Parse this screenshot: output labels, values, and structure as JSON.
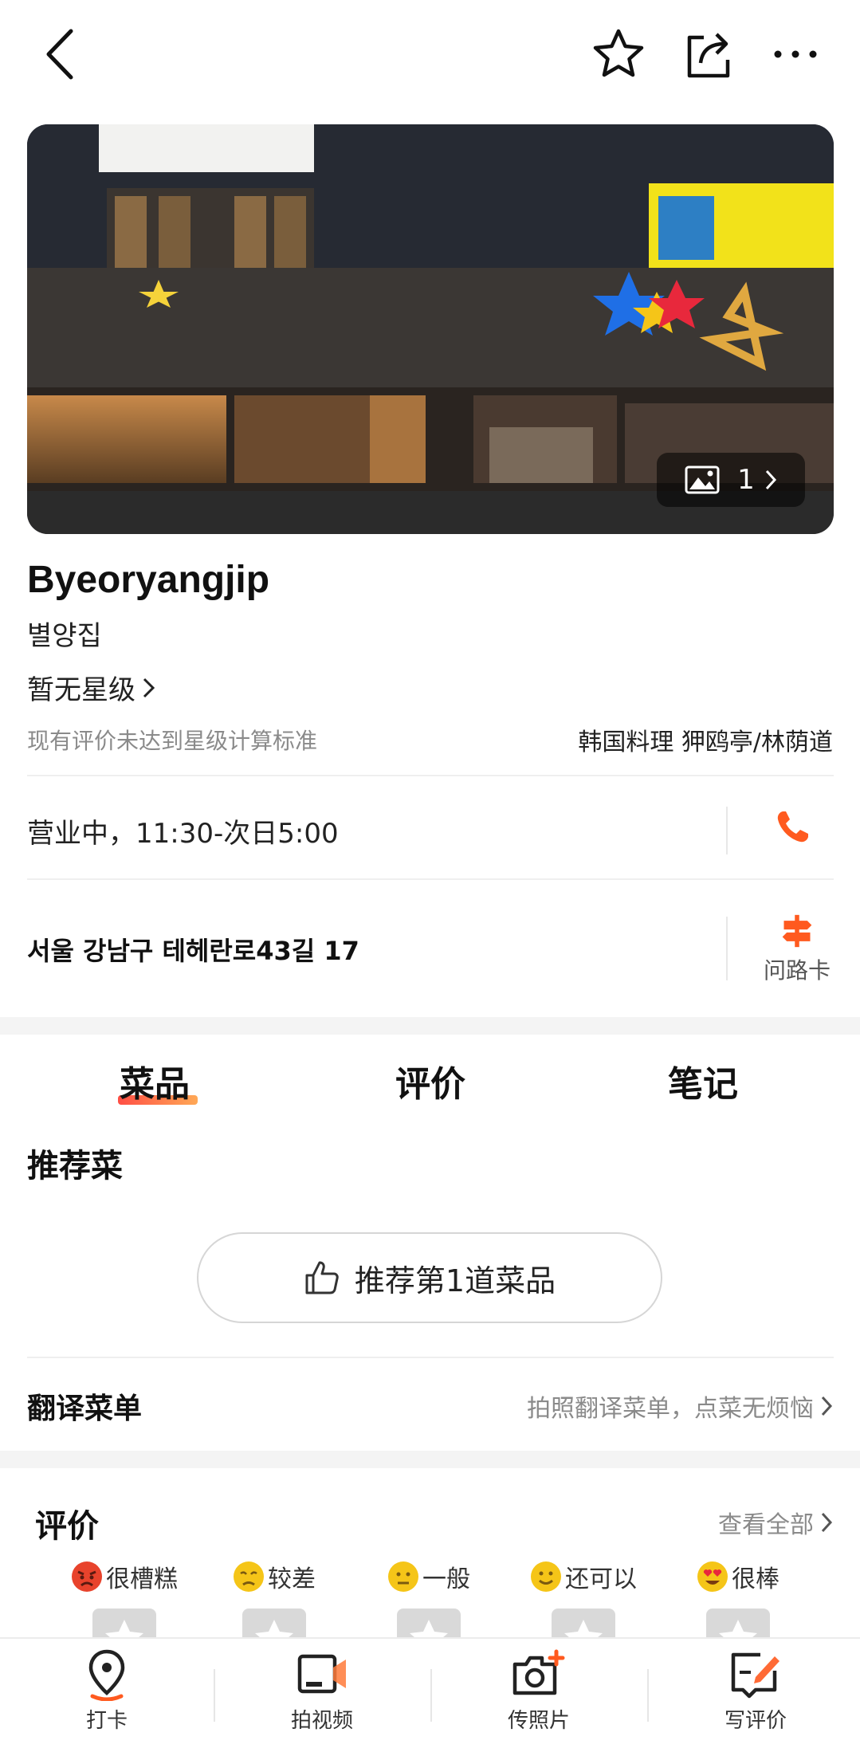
{
  "topbar": {
    "back_icon": "chevron-left-icon",
    "favorite_icon": "star-outline-icon",
    "share_icon": "share-icon",
    "more_icon": "more-dots-icon"
  },
  "hero": {
    "photo_count": "1",
    "photo_icon": "image-icon"
  },
  "restaurant": {
    "name_en": "Byeoryangjip",
    "name_local": "별양집",
    "rating_text": "暂无星级",
    "rating_note": "现有评价未达到星级计算标准",
    "category_area": "韩国料理 狎鸥亭/林荫道",
    "hours": "营业中，11:30-次日5:00",
    "address": "서울 강남구 테헤란로43길 17",
    "route_card_label": "问路卡"
  },
  "tabs": [
    {
      "label": "菜品",
      "active": true
    },
    {
      "label": "评价",
      "active": false
    },
    {
      "label": "笔记",
      "active": false
    }
  ],
  "dishes": {
    "section_title": "推荐菜",
    "recommend_button": "推荐第1道菜品",
    "translate_title": "翻译菜单",
    "translate_hint": "拍照翻译菜单，点菜无烦恼"
  },
  "reviews": {
    "section_title": "评价",
    "see_all": "查看全部",
    "options": [
      {
        "label": "很槽糕",
        "emoji": "angry-face-icon",
        "color": "#e8432c"
      },
      {
        "label": "较差",
        "emoji": "sad-face-icon",
        "color": "#f5c518"
      },
      {
        "label": "一般",
        "emoji": "neutral-face-icon",
        "color": "#f5c518"
      },
      {
        "label": "还可以",
        "emoji": "smile-face-icon",
        "color": "#f5c518"
      },
      {
        "label": "很棒",
        "emoji": "heart-eyes-face-icon",
        "color": "#f5c518"
      }
    ]
  },
  "bottom_nav": [
    {
      "label": "打卡",
      "icon": "location-pin-icon"
    },
    {
      "label": "拍视频",
      "icon": "video-camera-icon"
    },
    {
      "label": "传照片",
      "icon": "camera-plus-icon"
    },
    {
      "label": "写评价",
      "icon": "edit-review-icon"
    }
  ],
  "colors": {
    "accent": "#ff5a1f",
    "accent_gradient_start": "#ff3b30",
    "accent_gradient_end": "#ff9f43"
  }
}
